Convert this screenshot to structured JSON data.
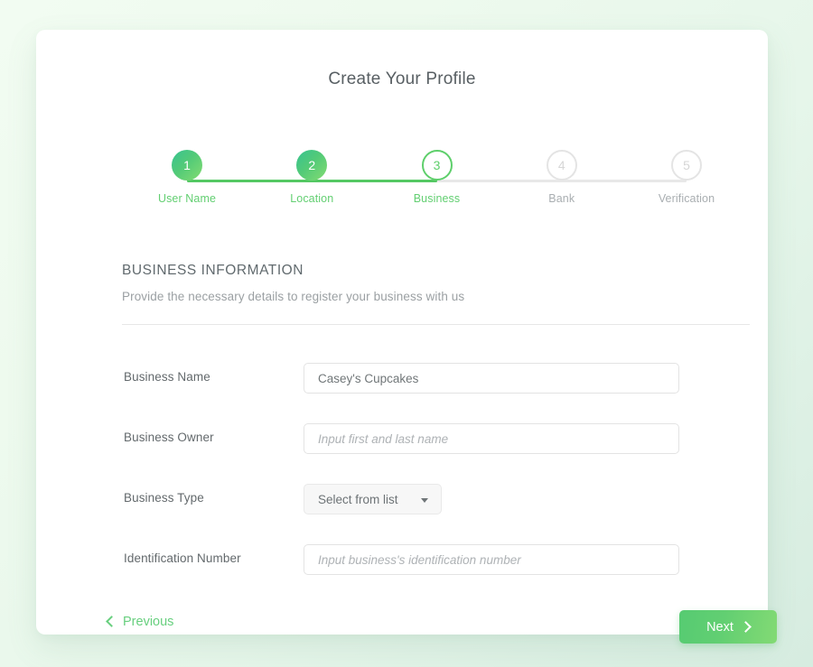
{
  "card": {
    "title": "Create Your Profile"
  },
  "stepper": {
    "steps": [
      {
        "number": "1",
        "label": "User Name",
        "state": "done"
      },
      {
        "number": "2",
        "label": "Location",
        "state": "done"
      },
      {
        "number": "3",
        "label": "Business",
        "state": "current"
      },
      {
        "number": "4",
        "label": "Bank",
        "state": "todo"
      },
      {
        "number": "5",
        "label": "Verification",
        "state": "todo"
      }
    ],
    "active_color": "#5ecf6b",
    "inactive_color": "#a9aeb1",
    "track_color": "#e8e8e8",
    "track_fill_color": "#54c863"
  },
  "section": {
    "title": "BUSINESS INFORMATION",
    "subtitle": "Provide the necessary details to register your business with us"
  },
  "form": {
    "fields": [
      {
        "label": "Business Name",
        "type": "text",
        "value": "Casey's Cupcakes",
        "placeholder": "",
        "filled": true
      },
      {
        "label": "Business Owner",
        "type": "text",
        "value": "",
        "placeholder": "Input first and last name",
        "filled": false
      },
      {
        "label": "Business Type",
        "type": "select",
        "value": "Select from list",
        "placeholder": "Select from list",
        "filled": false
      },
      {
        "label": "Identification Number",
        "type": "text",
        "value": "",
        "placeholder": "Input business's identification number",
        "filled": false
      }
    ]
  },
  "footer": {
    "previous_label": "Previous",
    "next_label": "Next"
  }
}
